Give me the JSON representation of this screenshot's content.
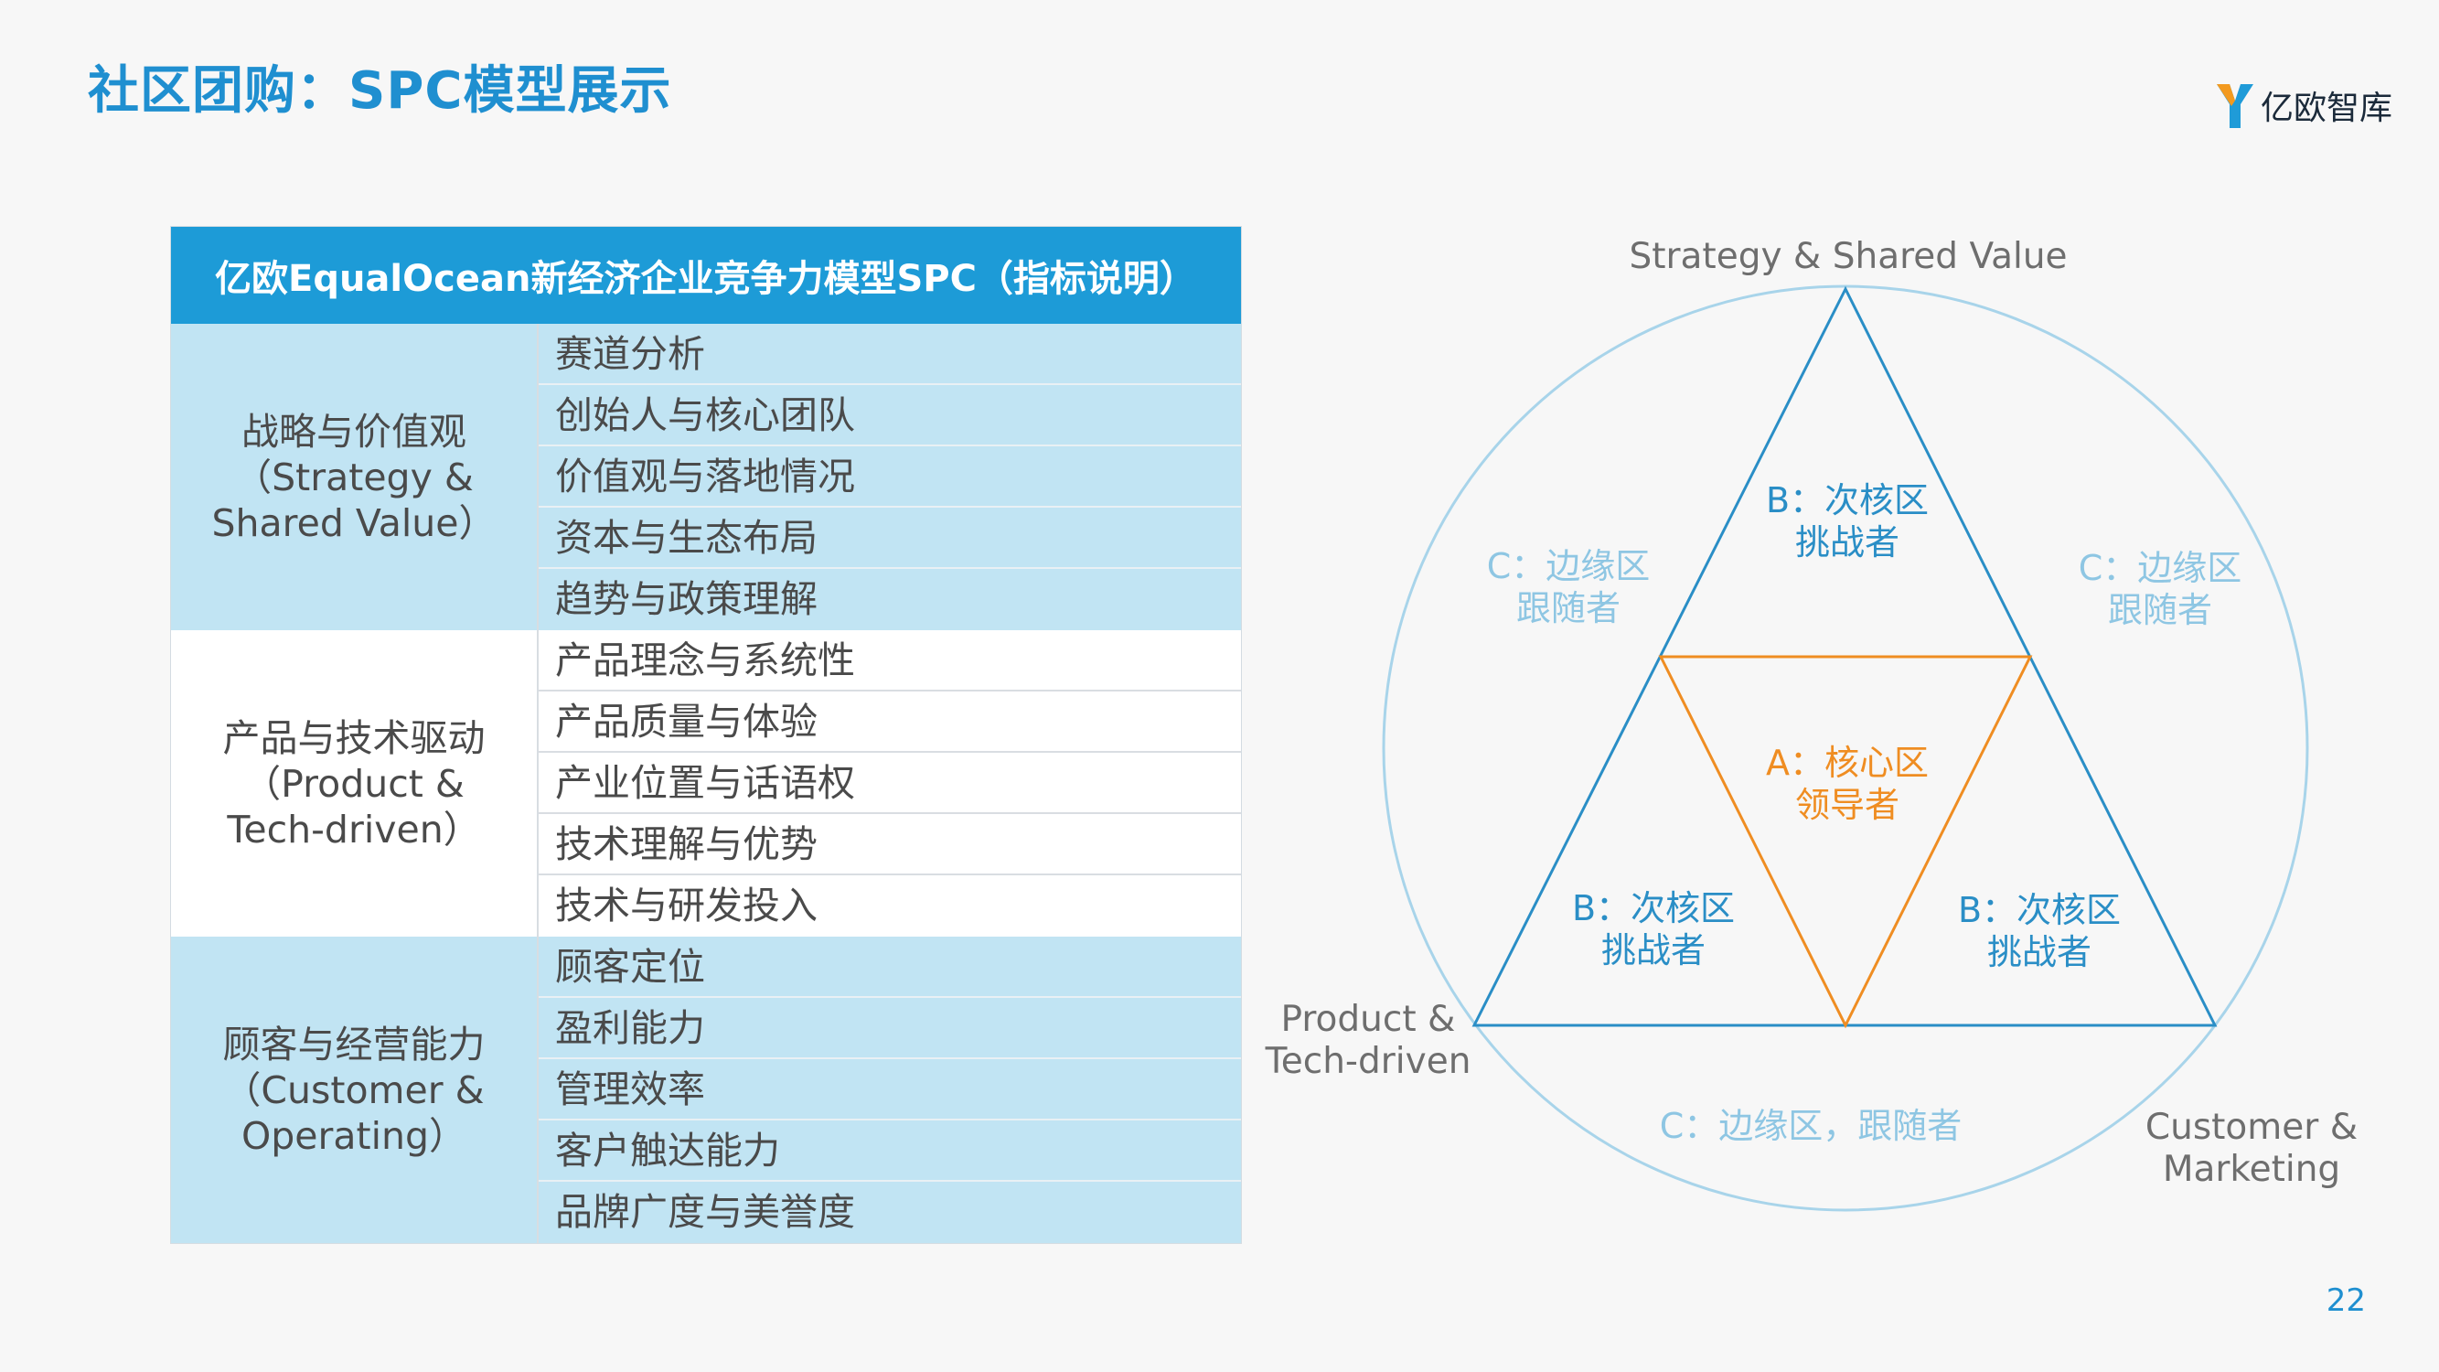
{
  "title": "社区团购：SPC模型展示",
  "brand": {
    "name": "亿欧智库",
    "logo_icon": "y-logo-icon"
  },
  "page_number": "22",
  "table": {
    "header": "亿欧EqualOcean新经济企业竞争力模型SPC（指标说明）",
    "groups": [
      {
        "label_cn": "战略与价值观",
        "label_en_1": "（Strategy &",
        "label_en_2": "Shared Value）",
        "items": [
          "赛道分析",
          "创始人与核心团队",
          "价值观与落地情况",
          "资本与生态布局",
          "趋势与政策理解"
        ]
      },
      {
        "label_cn": "产品与技术驱动",
        "label_en_1": "（Product &",
        "label_en_2": "Tech-driven）",
        "items": [
          "产品理念与系统性",
          "产品质量与体验",
          "产业位置与话语权",
          "技术理解与优势",
          "技术与研发投入"
        ]
      },
      {
        "label_cn": "顾客与经营能力",
        "label_en_1": "（Customer &",
        "label_en_2": "Operating）",
        "items": [
          "顾客定位",
          "盈利能力",
          "管理效率",
          "客户触达能力",
          "品牌广度与美誉度"
        ]
      }
    ]
  },
  "diagram": {
    "top_label": "Strategy & Shared Value",
    "left_label_1": "Product &",
    "left_label_2": "Tech-driven",
    "right_label_1": "Customer &",
    "right_label_2": "Marketing",
    "b_top_1": "B：次核区",
    "b_top_2": "挑战者",
    "b_left_1": "B：次核区",
    "b_left_2": "挑战者",
    "b_right_1": "B：次核区",
    "b_right_2": "挑战者",
    "a_center_1": "A：核心区",
    "a_center_2": "领导者",
    "c_left_1": "C：边缘区",
    "c_left_2": "跟随者",
    "c_right_1": "C：边缘区",
    "c_right_2": "跟随者",
    "c_bottom": "C：边缘区，跟随者",
    "colors": {
      "circle": "#a8d4ea",
      "triangle": "#2a8ec6",
      "core": "#ef8d22",
      "edge_text": "#8ec6e3",
      "axis_text": "#6e6e6e"
    }
  }
}
